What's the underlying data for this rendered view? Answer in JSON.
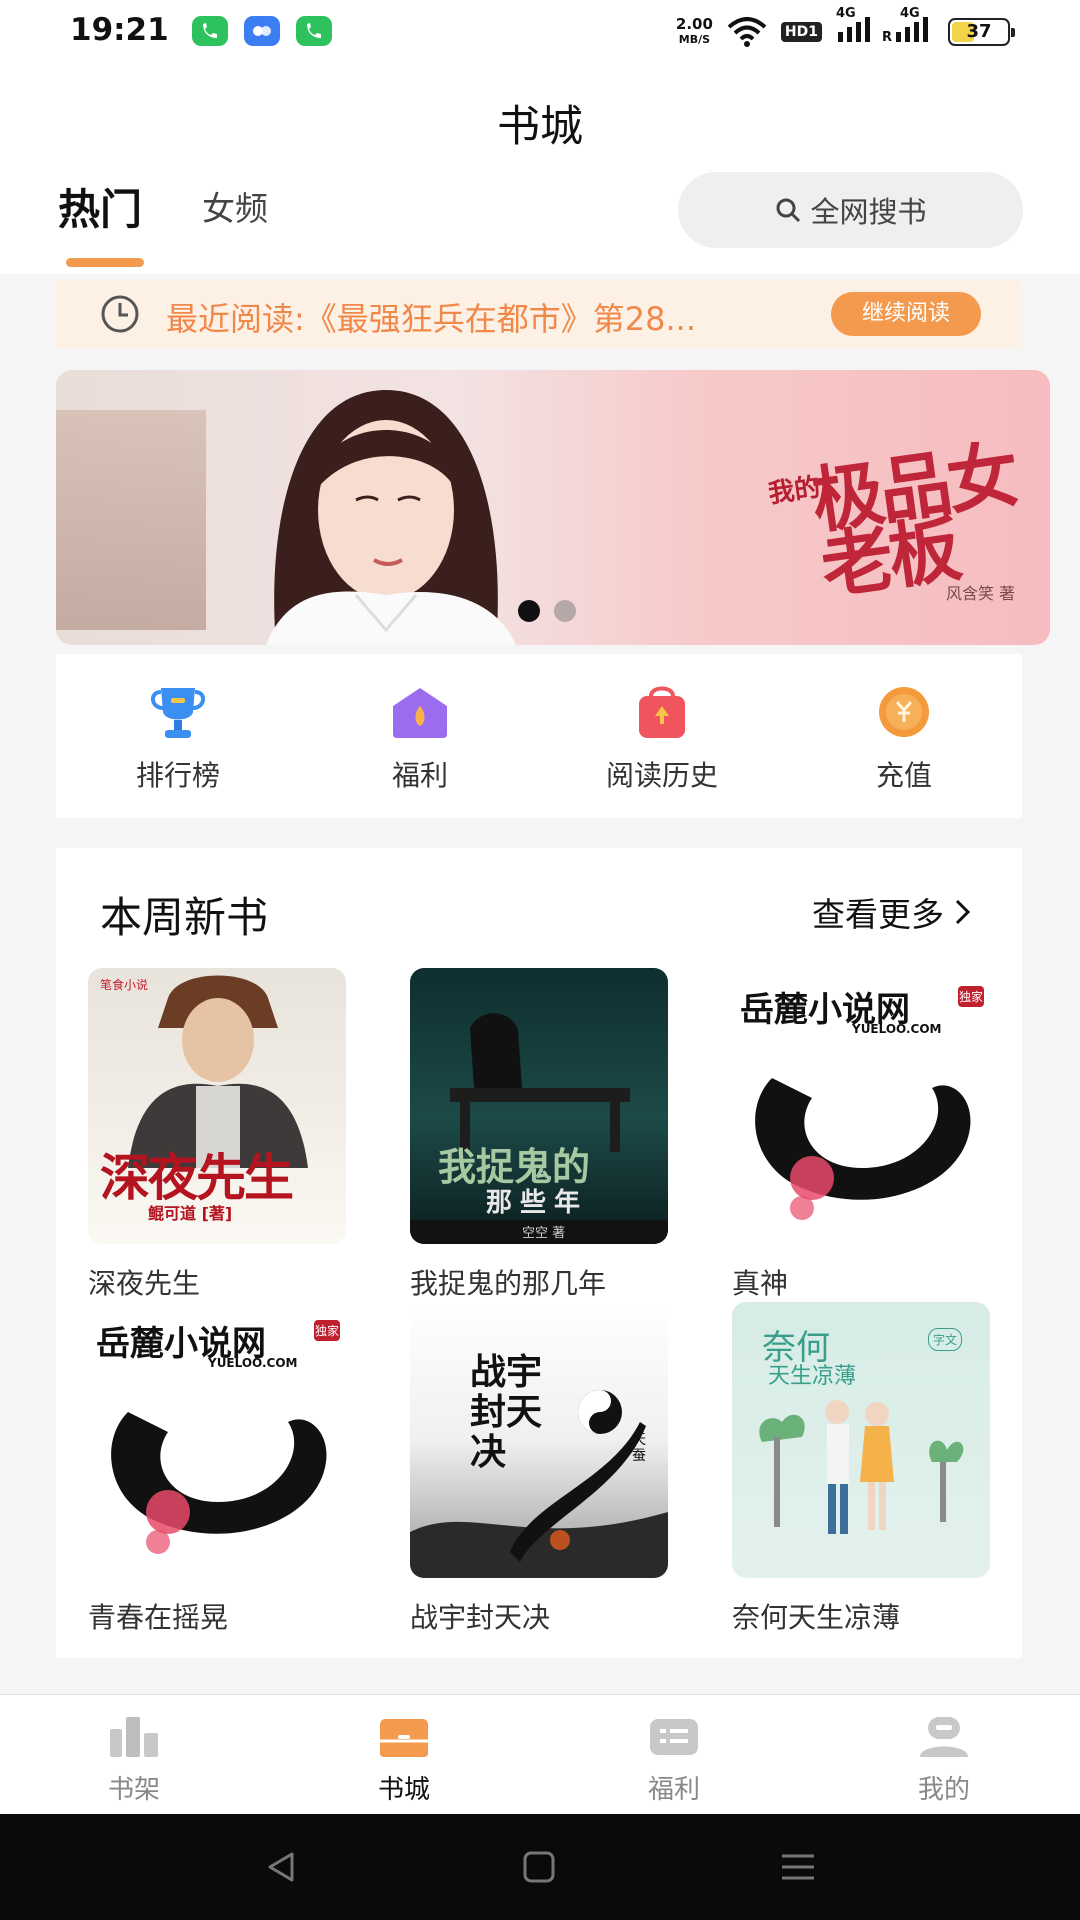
{
  "status_bar": {
    "time": "19:21",
    "speed_value": "2.00",
    "speed_unit": "MB/S",
    "hd": "HD1",
    "net1": "4G",
    "net2": "4G",
    "roaming": "R",
    "battery": "37"
  },
  "header": {
    "title": "书城",
    "tabs": [
      {
        "label": "热门",
        "active": true
      },
      {
        "label": "女频",
        "active": false
      }
    ],
    "search_label": "全网搜书"
  },
  "recent_reading": {
    "text": "最近阅读:《最强狂兵在都市》第28...",
    "button": "继续阅读"
  },
  "banner": {
    "title_small": "我的",
    "title_big": "极品女老板",
    "author": "风含笑 著",
    "dots": 2,
    "active_dot": 0
  },
  "quick_links": [
    {
      "label": "排行榜",
      "icon": "trophy-icon",
      "color": "#3a8ff0"
    },
    {
      "label": "福利",
      "icon": "gift-house-icon",
      "color": "#9b6cf0"
    },
    {
      "label": "阅读历史",
      "icon": "history-bag-icon",
      "color": "#f0545c"
    },
    {
      "label": "充值",
      "icon": "coin-icon",
      "color": "#f39a3c"
    }
  ],
  "new_books": {
    "title": "本周新书",
    "more": "查看更多",
    "books": [
      {
        "title": "深夜先生",
        "cover_text": "深夜先生",
        "cover_sub": "鲲可道 [著]",
        "publisher": "笔食小说"
      },
      {
        "title": "我捉鬼的那几年",
        "cover_text": "我捉鬼的",
        "cover_sub": "那些年",
        "author": "空空 著"
      },
      {
        "title": "真神",
        "cover_text": "岳麓小说网",
        "cover_sub": "YUELOO.COM",
        "badge": "独家"
      },
      {
        "title": "青春在摇晃",
        "cover_text": "岳麓小说网",
        "cover_sub": "YUELOO.COM",
        "badge": "独家"
      },
      {
        "title": "战宇封天决",
        "cover_text": "战宇封天决",
        "cover_sub": "天蚕"
      },
      {
        "title": "奈何天生凉薄",
        "cover_text": "奈何",
        "cover_sub": "天生凉薄",
        "badge": "字文"
      }
    ]
  },
  "bottom_nav": [
    {
      "label": "书架",
      "active": false
    },
    {
      "label": "书城",
      "active": true
    },
    {
      "label": "福利",
      "active": false
    },
    {
      "label": "我的",
      "active": false
    }
  ],
  "colors": {
    "accent": "#f39a4e",
    "recent_bg": "#fdf1e6",
    "recent_text": "#f0884a"
  }
}
